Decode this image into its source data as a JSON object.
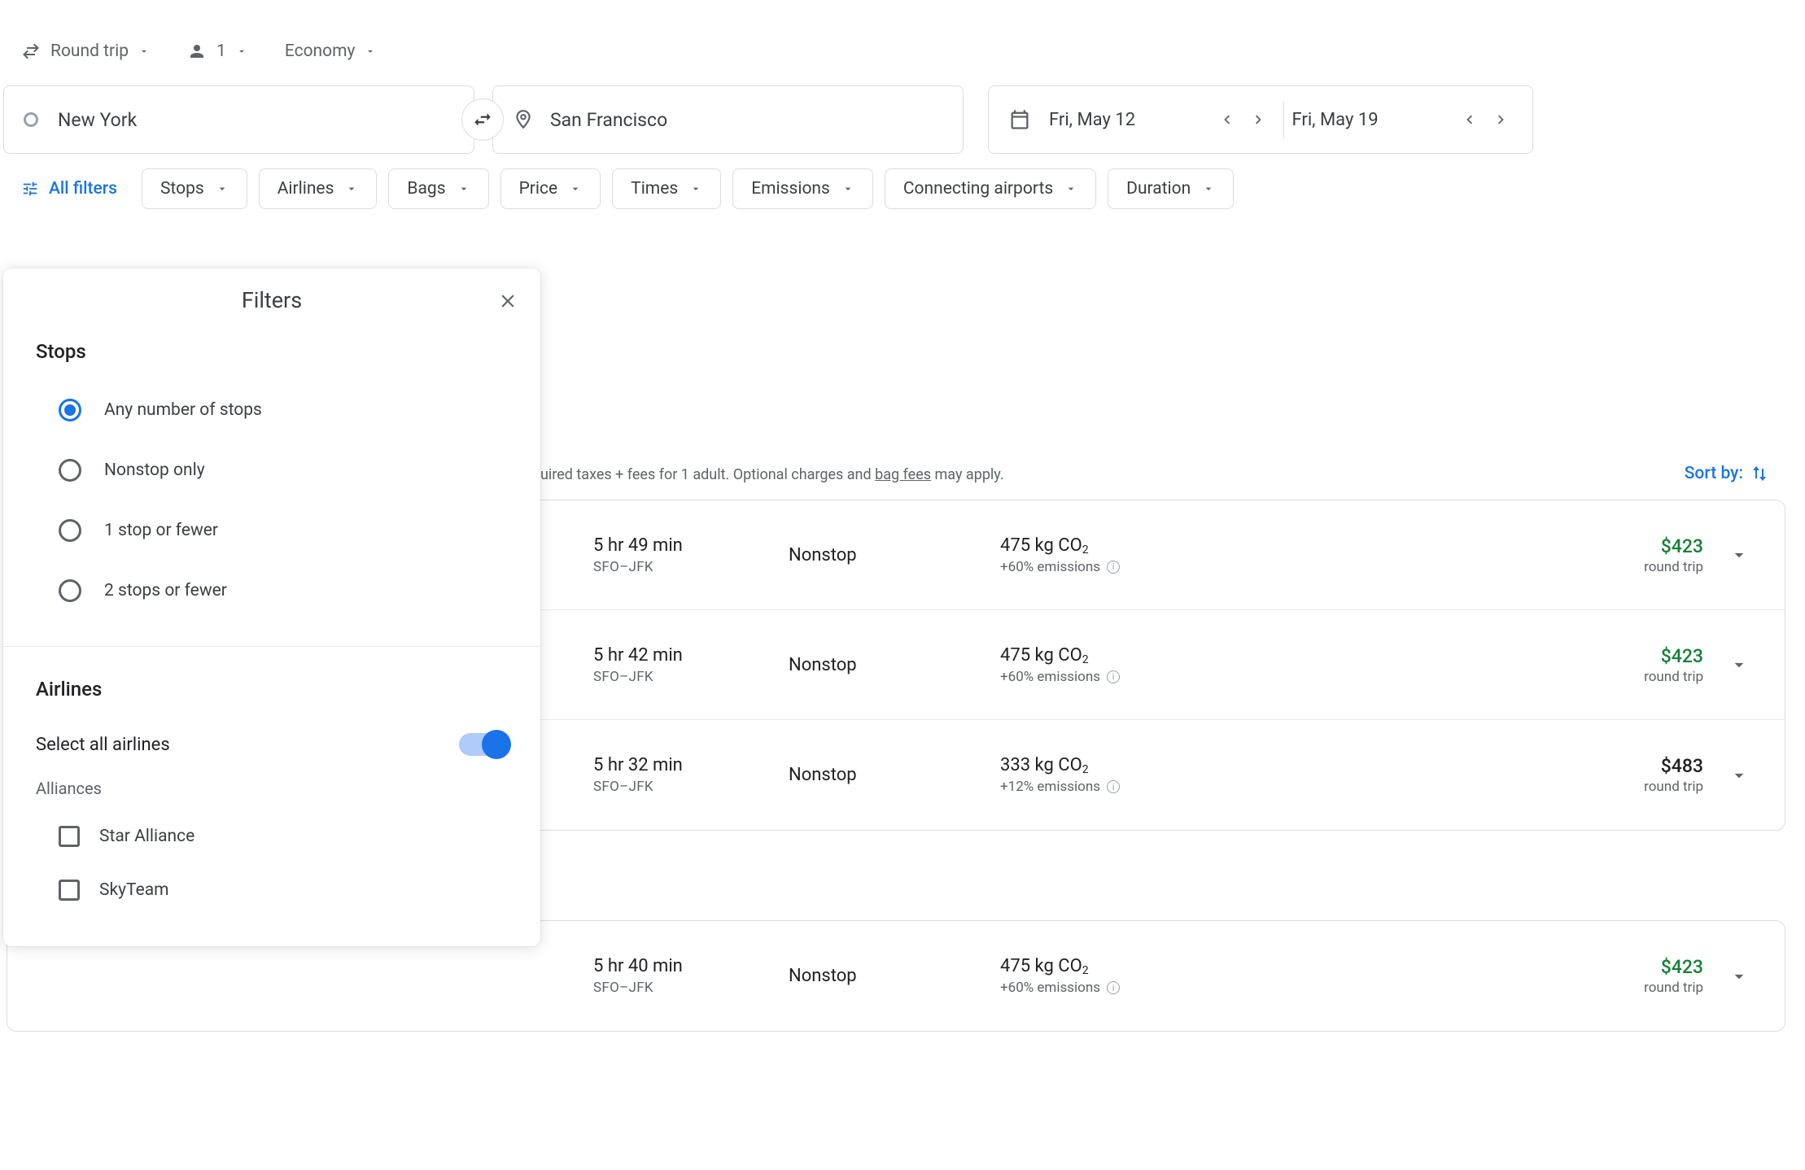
{
  "trip_options": {
    "trip_type": "Round trip",
    "passengers": "1",
    "cabin": "Economy"
  },
  "search": {
    "origin": "New York",
    "destination": "San Francisco",
    "depart_date": "Fri, May 12",
    "return_date": "Fri, May 19"
  },
  "filters_bar": {
    "all_filters": "All filters",
    "chips": [
      "Stops",
      "Airlines",
      "Bags",
      "Price",
      "Times",
      "Emissions",
      "Connecting airports",
      "Duration"
    ]
  },
  "filters_panel": {
    "title": "Filters",
    "stops": {
      "title": "Stops",
      "options": [
        "Any number of stops",
        "Nonstop only",
        "1 stop or fewer",
        "2 stops or fewer"
      ],
      "selected_index": 0
    },
    "airlines": {
      "title": "Airlines",
      "select_all_label": "Select all airlines",
      "select_all_on": true,
      "alliances_label": "Alliances",
      "alliances": [
        "Star Alliance",
        "SkyTeam"
      ]
    }
  },
  "results": {
    "disclaimer_suffix": "uired taxes + fees for 1 adult. Optional charges and ",
    "bag_fees_label": "bag fees",
    "disclaimer_tail": " may apply.",
    "sort_by_label": "Sort by:",
    "groups": [
      {
        "rows": [
          {
            "duration": "5 hr 49 min",
            "route": "SFO–JFK",
            "stops": "Nonstop",
            "co2": "475 kg CO",
            "co2_sub": "2",
            "emis_note": "+60% emissions",
            "price": "$423",
            "price_color": "green",
            "price_sub": "round trip"
          },
          {
            "duration": "5 hr 42 min",
            "route": "SFO–JFK",
            "stops": "Nonstop",
            "co2": "475 kg CO",
            "co2_sub": "2",
            "emis_note": "+60% emissions",
            "price": "$423",
            "price_color": "green",
            "price_sub": "round trip"
          },
          {
            "duration": "5 hr 32 min",
            "route": "SFO–JFK",
            "stops": "Nonstop",
            "co2": "333 kg CO",
            "co2_sub": "2",
            "emis_note": "+12% emissions",
            "price": "$483",
            "price_color": "black",
            "price_sub": "round trip"
          }
        ]
      },
      {
        "rows": [
          {
            "duration": "5 hr 40 min",
            "route": "SFO–JFK",
            "stops": "Nonstop",
            "co2": "475 kg CO",
            "co2_sub": "2",
            "emis_note": "+60% emissions",
            "price": "$423",
            "price_color": "green",
            "price_sub": "round trip"
          }
        ]
      }
    ]
  }
}
